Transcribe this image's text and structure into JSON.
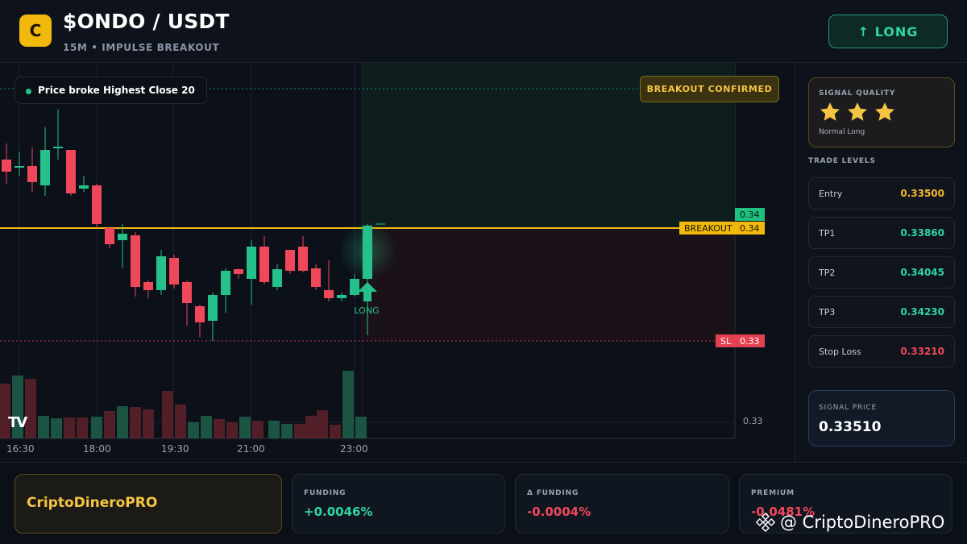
{
  "header": {
    "logo_letter": "C",
    "pair": "$ONDO / USDT",
    "subtitle": "15M • IMPULSE BREAKOUT",
    "long_button": "↑ LONG"
  },
  "chart": {
    "tooltip": "Price broke Highest Close 20",
    "badge": "BREAKOUT CONFIRMED",
    "long_marker_label": "LONG",
    "breakout_label": "BREAKOUT",
    "sl_label": "SL",
    "price_tags": {
      "upper": "0.34",
      "breakout": "0.34",
      "sl": "0.33",
      "axis": "0.33"
    },
    "time_labels": [
      "16:30",
      "18:00",
      "19:30",
      "21:00",
      "23:00"
    ],
    "colors": {
      "bull": "#26c08b",
      "bear": "#f0485b",
      "breakout": "#f0b90b"
    },
    "tv_logo": "TV"
  },
  "panel": {
    "quality_title": "SIGNAL QUALITY",
    "stars": 3,
    "quality_note": "Normal Long",
    "levels_title": "TRADE LEVELS",
    "levels": [
      {
        "label": "Entry",
        "value": "0.33500",
        "color": "#f5b82e"
      },
      {
        "label": "TP1",
        "value": "0.33860",
        "color": "#2fd6a0"
      },
      {
        "label": "TP2",
        "value": "0.34045",
        "color": "#2fd6a0"
      },
      {
        "label": "TP3",
        "value": "0.34230",
        "color": "#2fd6a0"
      },
      {
        "label": "Stop Loss",
        "value": "0.33210",
        "color": "#f0485b"
      }
    ],
    "signal_price_title": "SIGNAL PRICE",
    "signal_price": "0.33510"
  },
  "footer": {
    "brand": "CriptoDineroPRO",
    "stats": [
      {
        "title": "FUNDING",
        "value": "+0.0046%",
        "color": "#2fd6a0"
      },
      {
        "title": "Δ FUNDING",
        "value": "-0.0004%",
        "color": "#f0485b"
      },
      {
        "title": "PREMIUM",
        "value": "-0.0481%",
        "color": "#f0485b"
      }
    ],
    "watermark": "@ CriptoDineroPRO"
  }
}
